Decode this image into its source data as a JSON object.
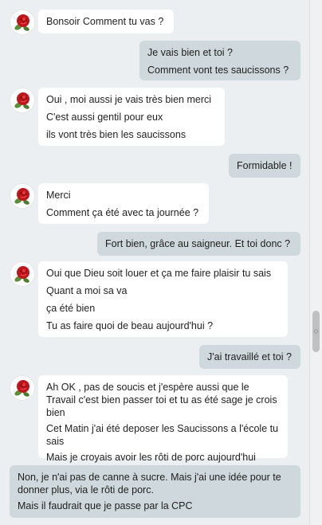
{
  "messages": [
    {
      "direction": "in",
      "lines": [
        "Bonsoir Comment tu vas ?"
      ]
    },
    {
      "direction": "out",
      "lines": [
        "Je vais bien et toi ?",
        "Comment vont tes saucissons ?"
      ]
    },
    {
      "direction": "in",
      "lines": [
        "Oui , moi aussi je vais très bien merci",
        "C'est aussi gentil pour eux",
        "ils vont très bien les saucissons"
      ]
    },
    {
      "direction": "out",
      "lines": [
        "Formidable !"
      ]
    },
    {
      "direction": "in",
      "lines": [
        "Merci",
        "Comment ça été avec ta journée ?"
      ]
    },
    {
      "direction": "out",
      "lines": [
        "Fort bien, grâce au saigneur. Et toi donc ?"
      ]
    },
    {
      "direction": "in",
      "lines": [
        "Oui que Dieu soit louer et ça me faire plaisir tu sais",
        "Quant a moi sa va",
        "ça été bien",
        "Tu as faire quoi de beau aujourd'hui ?"
      ]
    },
    {
      "direction": "out",
      "lines": [
        "J'ai travaillé et toi ?"
      ]
    },
    {
      "direction": "in",
      "lines": [
        "Ah OK , pas de soucis et j'espère aussi que le Travail c'est bien passer toi et tu as été sage je crois bien",
        "Cet Matin j'ai été deposer les Saucissons a l'école tu sais",
        "Mais je croyais avoir les  rôti de porc  aujourd'hui"
      ]
    },
    {
      "direction": "draft",
      "lines": [
        "Non, je n'ai pas de canne à sucre. Mais j'ai une idée pour te donner plus, via le rôti de porc.",
        "Mais il faudrait que je passe par la CPC"
      ]
    }
  ],
  "icons": {
    "avatar": "rose-avatar-icon",
    "scroll_grip": "scroll-grip-icon"
  },
  "colors": {
    "background": "#eceff1",
    "incoming": "#ffffff",
    "outgoing": "#cfd8dc"
  }
}
